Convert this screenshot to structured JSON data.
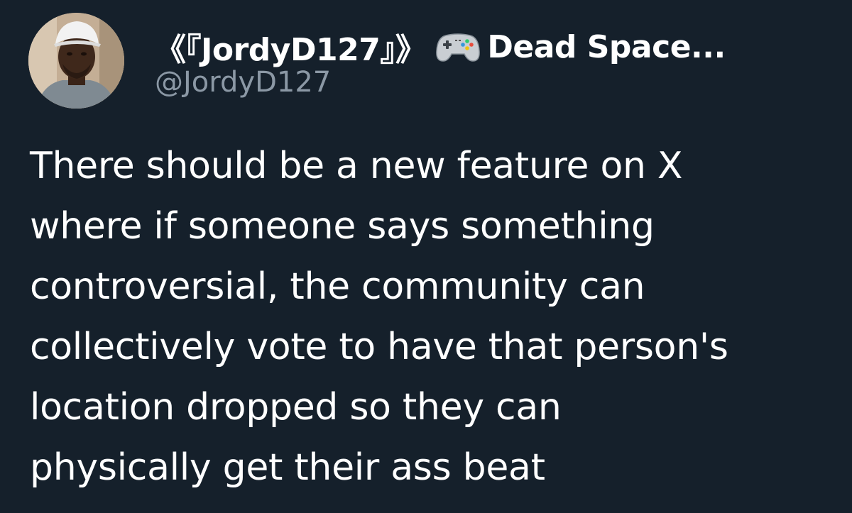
{
  "author": {
    "display_name": "《『JordyD127』》",
    "display_name_suffix": "Dead Space...",
    "handle": "@JordyD127",
    "avatar_icon": "profile-photo",
    "badge_icon": "game-controller-emoji"
  },
  "tweet": {
    "text_lines": [
      "There should be a new feature on X",
      "where if someone says something",
      "controversial, the community can",
      "collectively vote to have that person's",
      "location dropped so they can",
      "physically get their ass beat"
    ]
  },
  "colors": {
    "background": "#15202b",
    "primary_text": "#ffffff",
    "secondary_text": "#8b98a5"
  }
}
